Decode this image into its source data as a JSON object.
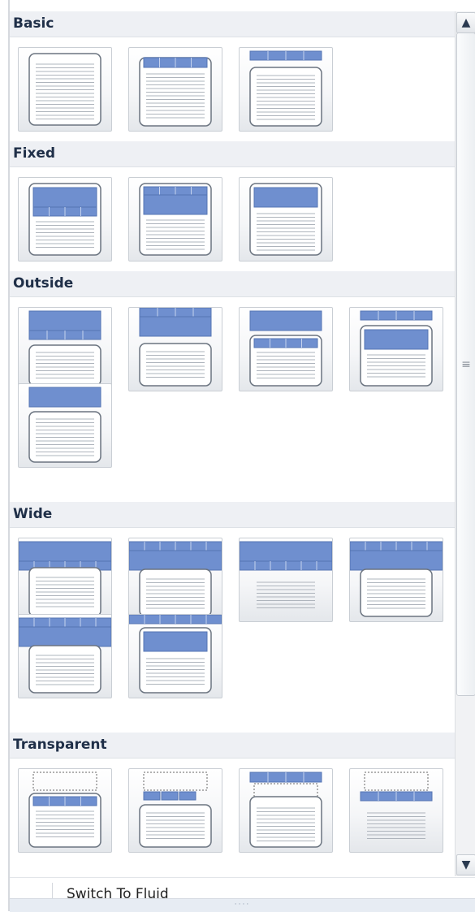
{
  "categories": [
    {
      "name": "Basic",
      "layouts": [
        "basic-1",
        "basic-2",
        "basic-3"
      ]
    },
    {
      "name": "Fixed",
      "layouts": [
        "fixed-1",
        "fixed-2",
        "fixed-3"
      ]
    },
    {
      "name": "Outside",
      "layouts": [
        "outside-1",
        "outside-2",
        "outside-3",
        "outside-4",
        "outside-5"
      ]
    },
    {
      "name": "Wide",
      "layouts": [
        "wide-1",
        "wide-2",
        "wide-3",
        "wide-4",
        "wide-5",
        "wide-6"
      ]
    },
    {
      "name": "Transparent",
      "layouts": [
        "transparent-1",
        "transparent-2",
        "transparent-3",
        "transparent-4"
      ]
    }
  ],
  "menu": {
    "switch_label": "Switch To Fluid"
  },
  "scrollbar": {
    "up_icon": "arrow-up-icon",
    "down_icon": "arrow-down-icon",
    "grip_icon": "grip-icon"
  },
  "colors": {
    "header_blue": "#6f8fcf",
    "border": "#6b7480",
    "category_bg": "#eef0f4"
  }
}
